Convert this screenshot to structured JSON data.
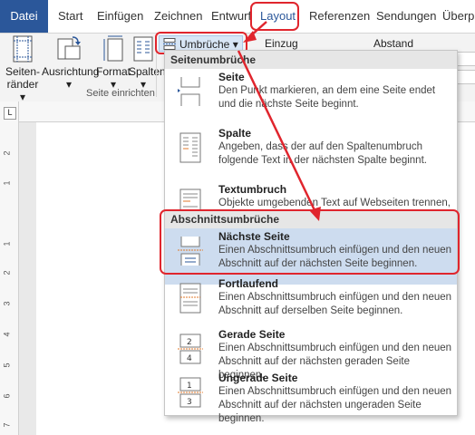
{
  "tabs": [
    "Datei",
    "Start",
    "Einfügen",
    "Zeichnen",
    "Entwurf",
    "Layout",
    "Referenzen",
    "Sendungen",
    "Überprü"
  ],
  "ribbon": {
    "buttons": [
      {
        "l1": "Seiten-",
        "l2": "ränder ▾"
      },
      {
        "l1": "Ausrichtung",
        "l2": "▾"
      },
      {
        "l1": "Format",
        "l2": "▾"
      },
      {
        "l1": "Spalten",
        "l2": "▾"
      }
    ],
    "group_label": "Seite einrichten",
    "umbrueche_label": "Umbrüche ▾",
    "einzug_label": "Einzug",
    "abstand_label": "Abstand"
  },
  "ruler": {
    "corner": "L",
    "numbers": [
      "2",
      "1",
      "1",
      "1",
      "2",
      "3",
      "4",
      "5",
      "6",
      "7"
    ]
  },
  "menu": {
    "sections": [
      "Seitenumbrüche",
      "Abschnittsumbrüche"
    ],
    "items": [
      {
        "title": "Seite",
        "desc": "Den Punkt markieren, an dem eine Seite endet und die nächste Seite beginnt."
      },
      {
        "title": "Spalte",
        "desc": "Angeben, dass der auf den Spaltenumbruch folgende Text in der nächsten Spalte beginnt."
      },
      {
        "title": "Textumbruch",
        "desc": "Objekte umgebenden Text auf Webseiten trennen, z. B. Beschriftungstext vom Textkörper."
      },
      {
        "title": "Nächste Seite",
        "desc": "Einen Abschnittsumbruch einfügen und den neuen Abschnitt auf der nächsten Seite beginnen."
      },
      {
        "title": "Fortlaufend",
        "desc": "Einen Abschnittsumbruch einfügen und den neuen Abschnitt auf derselben Seite beginnen."
      },
      {
        "title": "Gerade Seite",
        "desc": "Einen Abschnittsumbruch einfügen und den neuen Abschnitt auf der nächsten geraden Seite beginnen."
      },
      {
        "title": "Ungerade Seite",
        "desc": "Einen Abschnittsumbruch einfügen und den neuen Abschnitt auf der nächsten ungeraden Seite beginnen."
      }
    ]
  },
  "colors": {
    "accent": "#2b579a",
    "highlight": "#e0252d",
    "selected": "#cddcef"
  }
}
